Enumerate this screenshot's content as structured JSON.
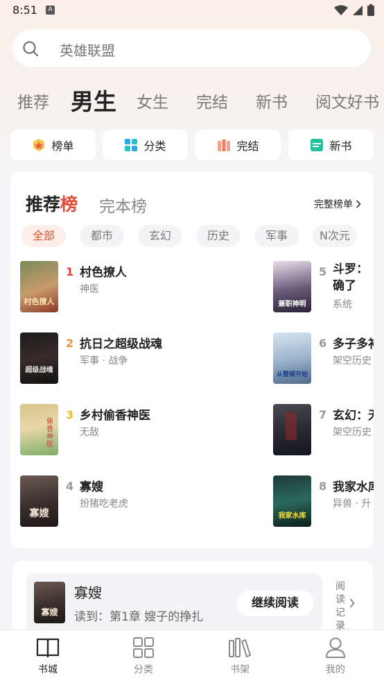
{
  "status": {
    "time": "8:51",
    "a_icon": "A"
  },
  "search": {
    "placeholder": "英雄联盟"
  },
  "tabs": [
    "推荐",
    "男生",
    "女生",
    "完结",
    "新书",
    "阅文好书"
  ],
  "active_tab": "男生",
  "quick_links": [
    {
      "label": "榜单",
      "icon": "ranking-medal-icon"
    },
    {
      "label": "分类",
      "icon": "category-grid-icon"
    },
    {
      "label": "完结",
      "icon": "books-icon"
    },
    {
      "label": "新书",
      "icon": "new-book-icon"
    }
  ],
  "ranking": {
    "title_main": "推荐",
    "title_accent": "榜",
    "alt_title": "完本榜",
    "full_link": "完整榜单",
    "chips": [
      "全部",
      "都市",
      "玄幻",
      "历史",
      "军事",
      "N次元"
    ],
    "books": [
      {
        "rank": "1",
        "title": "村色撩人",
        "meta": "神医",
        "cover_text": "村色撩人"
      },
      {
        "rank": "2",
        "title": "抗日之超级战魂",
        "meta": "军事 · 战争",
        "cover_text": "超级战魂"
      },
      {
        "rank": "3",
        "title": "乡村偷香神医",
        "meta": "无敌",
        "cover_text": "偷香神医"
      },
      {
        "rank": "4",
        "title": "寡嫂",
        "meta": "扮猪吃老虎",
        "cover_text": "寡嫂"
      },
      {
        "rank": "5",
        "title": "斗罗：确了",
        "meta": "系统",
        "cover_text": "兼职神明"
      },
      {
        "rank": "6",
        "title": "多子多补",
        "meta": "架空历史",
        "cover_text": "从整顿开始"
      },
      {
        "rank": "7",
        "title": "玄幻：无",
        "meta": "架空历史",
        "cover_text": ""
      },
      {
        "rank": "8",
        "title": "我家水库",
        "meta": "异兽 · 升",
        "cover_text": "我家水库"
      }
    ]
  },
  "continue_reading": {
    "title": "寡嫂",
    "progress": "读到：第1章 嫂子的挣扎",
    "button": "继续阅读",
    "history": "阅读记录",
    "cover_text": "寡嫂"
  },
  "tabbar": [
    {
      "label": "书城",
      "icon": "book-open-icon"
    },
    {
      "label": "分类",
      "icon": "grid-icon"
    },
    {
      "label": "书架",
      "icon": "bookshelf-icon"
    },
    {
      "label": "我的",
      "icon": "person-icon"
    }
  ],
  "colors": {
    "accent": "#e24a3a",
    "chip_active_bg": "#fdeee9",
    "chip_active_text": "#e2502e"
  }
}
